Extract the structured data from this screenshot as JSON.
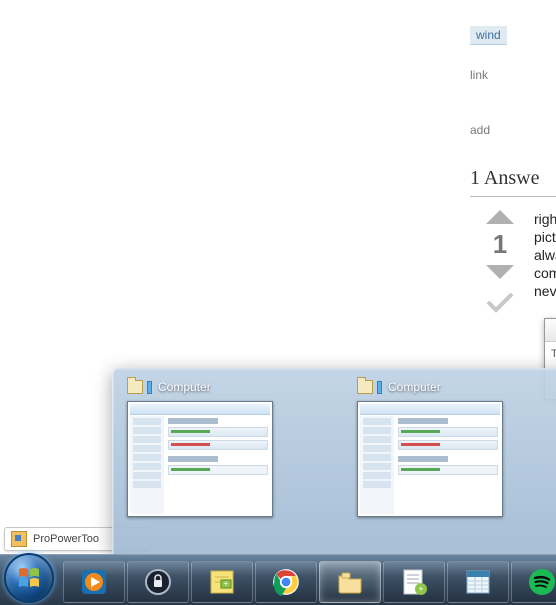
{
  "page": {
    "tag_label": "wind",
    "link_label": "link",
    "add_label": "add",
    "answers_heading": "1 Answe",
    "vote_score": "1",
    "answer_lines": [
      "righ",
      "pictu",
      "alwa",
      "com",
      "neve"
    ],
    "popup_text": "T"
  },
  "status_bar": {
    "label": "ProPowerToo"
  },
  "preview": {
    "windows": [
      {
        "title": "Computer"
      },
      {
        "title": "Computer"
      }
    ]
  },
  "taskbar": {
    "items": [
      {
        "name": "media-player-icon",
        "active": false
      },
      {
        "name": "secure-app-icon",
        "active": false
      },
      {
        "name": "sticky-notes-icon",
        "active": false
      },
      {
        "name": "chrome-icon",
        "active": false
      },
      {
        "name": "file-explorer-icon",
        "active": true
      },
      {
        "name": "notepad-plus-icon",
        "active": false
      },
      {
        "name": "spreadsheet-app-icon",
        "active": false
      },
      {
        "name": "spotify-icon",
        "active": false
      }
    ]
  }
}
